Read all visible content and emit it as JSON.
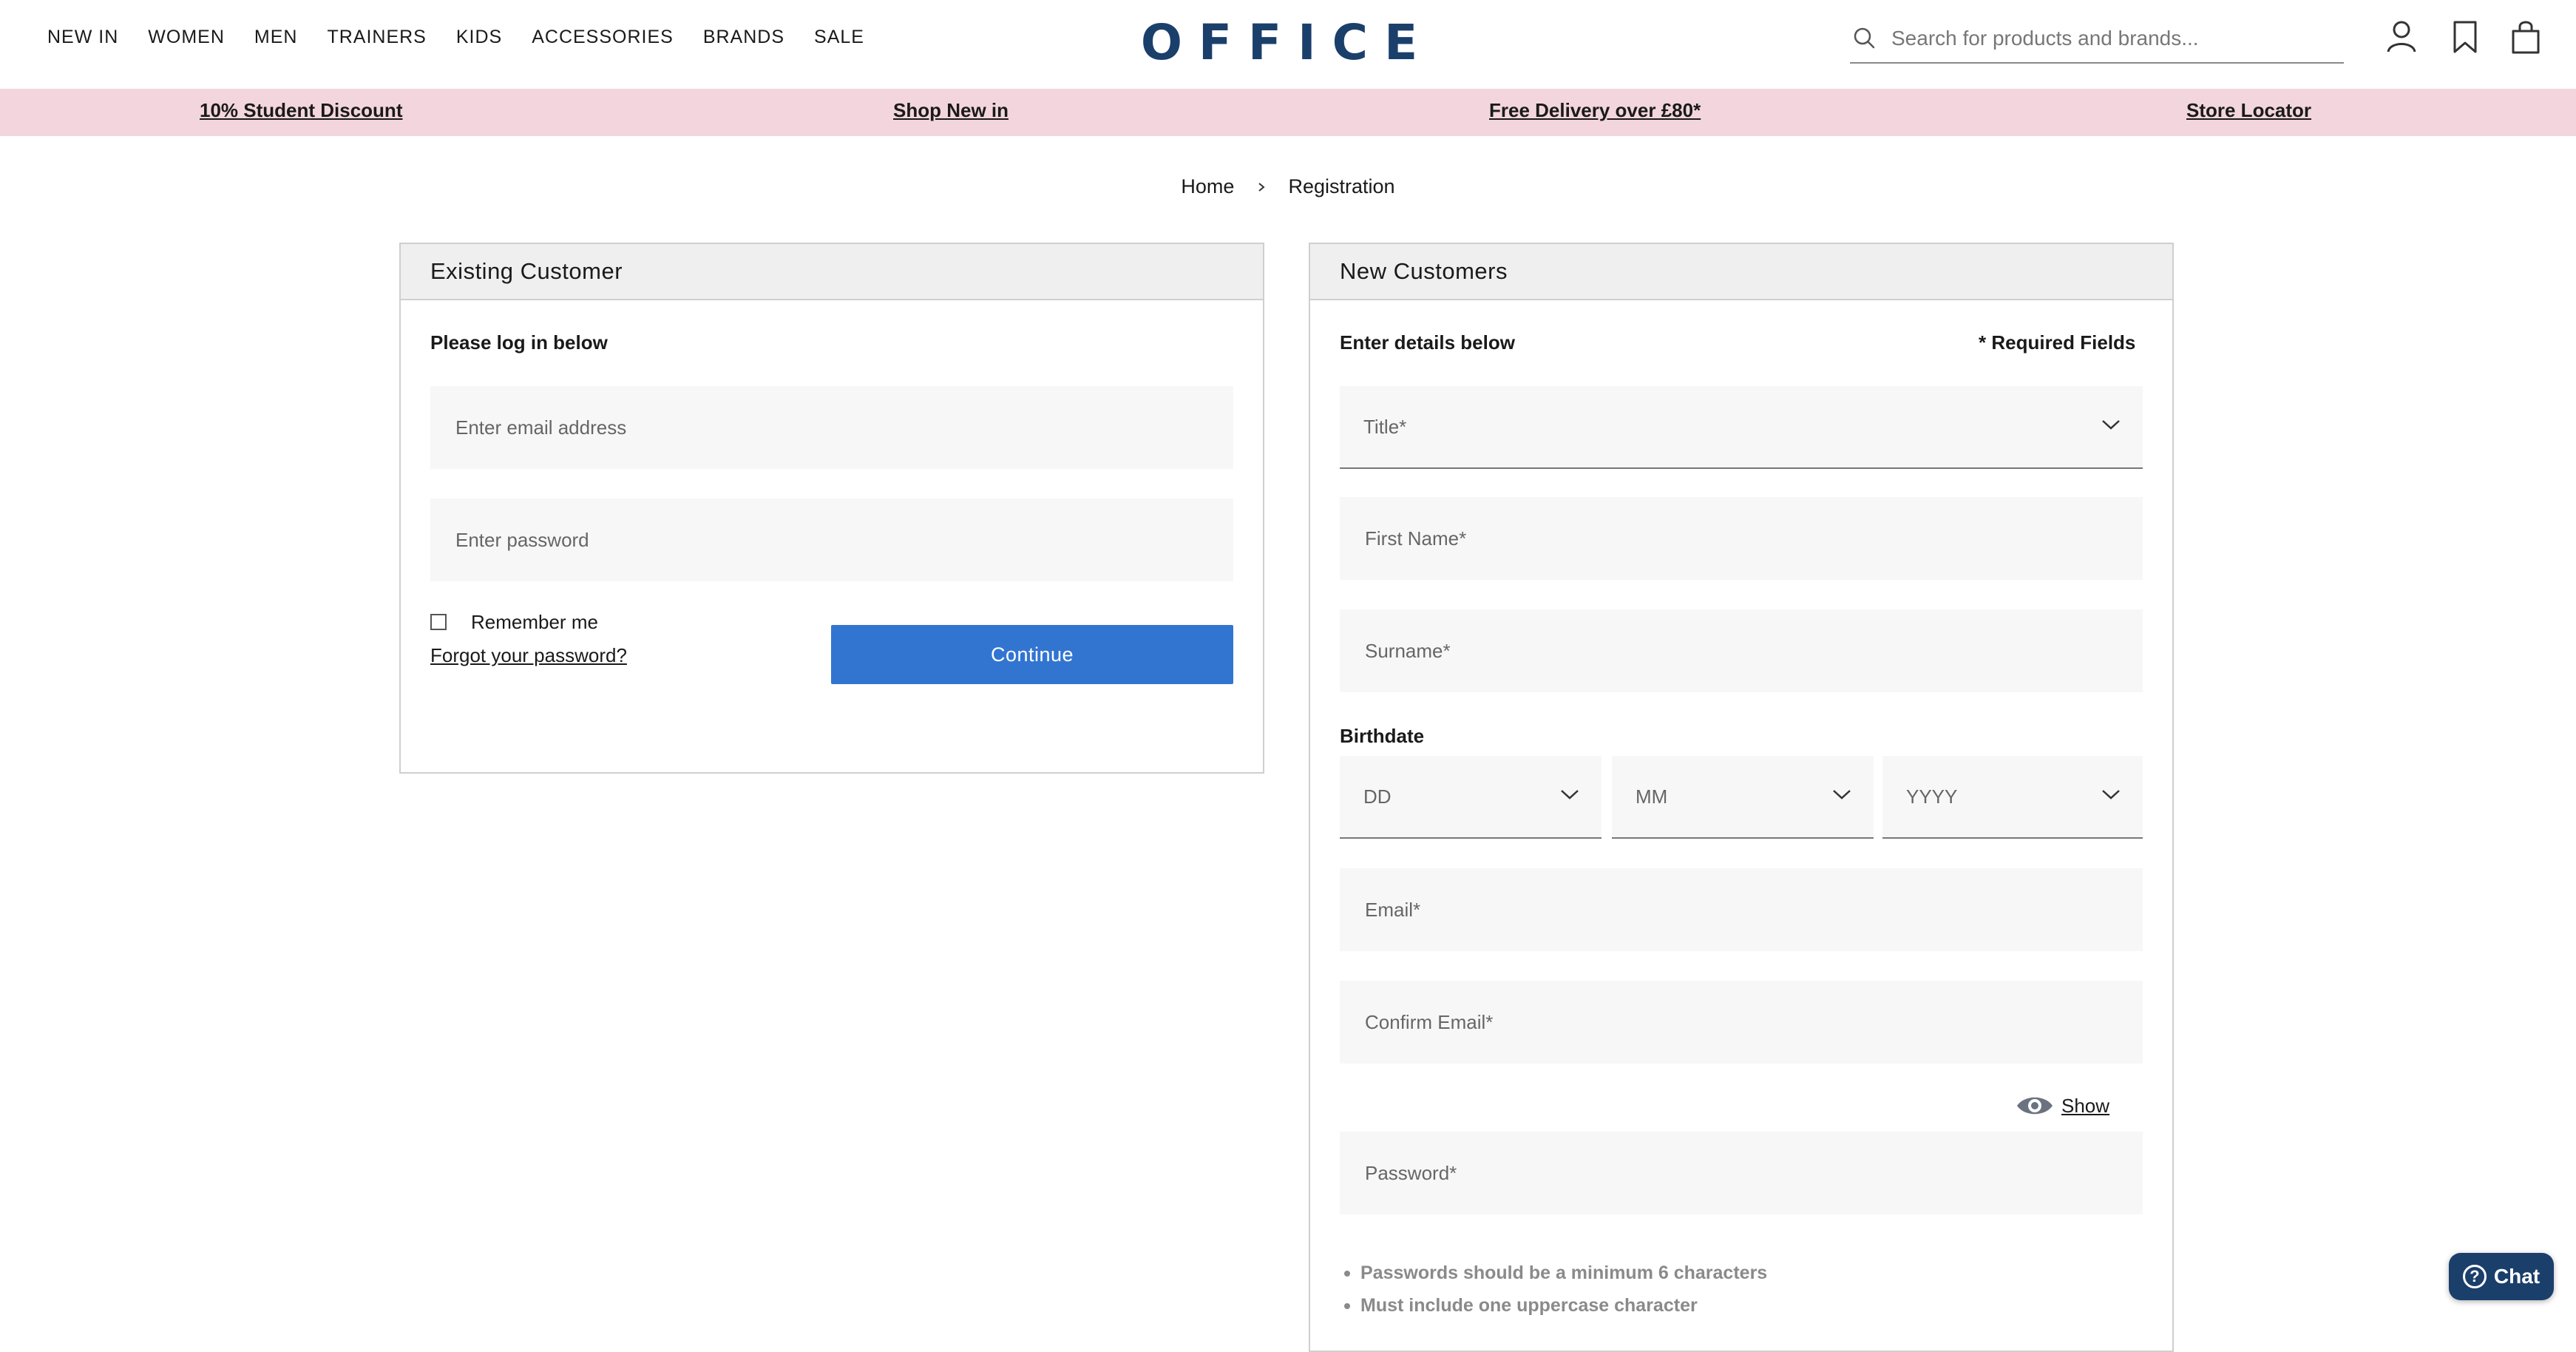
{
  "header": {
    "nav": [
      "NEW IN",
      "WOMEN",
      "MEN",
      "TRAINERS",
      "KIDS",
      "ACCESSORIES",
      "BRANDS",
      "SALE"
    ],
    "logo_text": "OFFICE",
    "search_placeholder": "Search for products and brands...",
    "icons": [
      "account-icon",
      "bookmark-icon",
      "bag-icon"
    ]
  },
  "promo": {
    "items": [
      "10% Student Discount",
      "Shop New in",
      "Free Delivery over £80*",
      "Store Locator"
    ]
  },
  "breadcrumb": {
    "home": "Home",
    "current": "Registration"
  },
  "existing": {
    "title": "Existing Customer",
    "subtitle": "Please log in below",
    "email_placeholder": "Enter email address",
    "password_placeholder": "Enter password",
    "remember": "Remember me",
    "forgot": "Forgot your password?",
    "continue": "Continue"
  },
  "new_customer": {
    "title": "New Customers",
    "subtitle": "Enter details below",
    "required": "* Required Fields",
    "title_select": "Title*",
    "first_name": "First Name*",
    "surname": "Surname*",
    "birthdate_label": "Birthdate",
    "dd": "DD",
    "mm": "MM",
    "yyyy": "YYYY",
    "email": "Email*",
    "confirm_email": "Confirm Email*",
    "show": "Show",
    "password": "Password*",
    "rules": [
      "Passwords should be a minimum 6 characters",
      "Must include one uppercase character"
    ]
  },
  "chat": {
    "label": "Chat"
  },
  "colors": {
    "brand": "#1b3f6b",
    "button": "#3275d1",
    "promo_bg": "#f3d6dd"
  }
}
